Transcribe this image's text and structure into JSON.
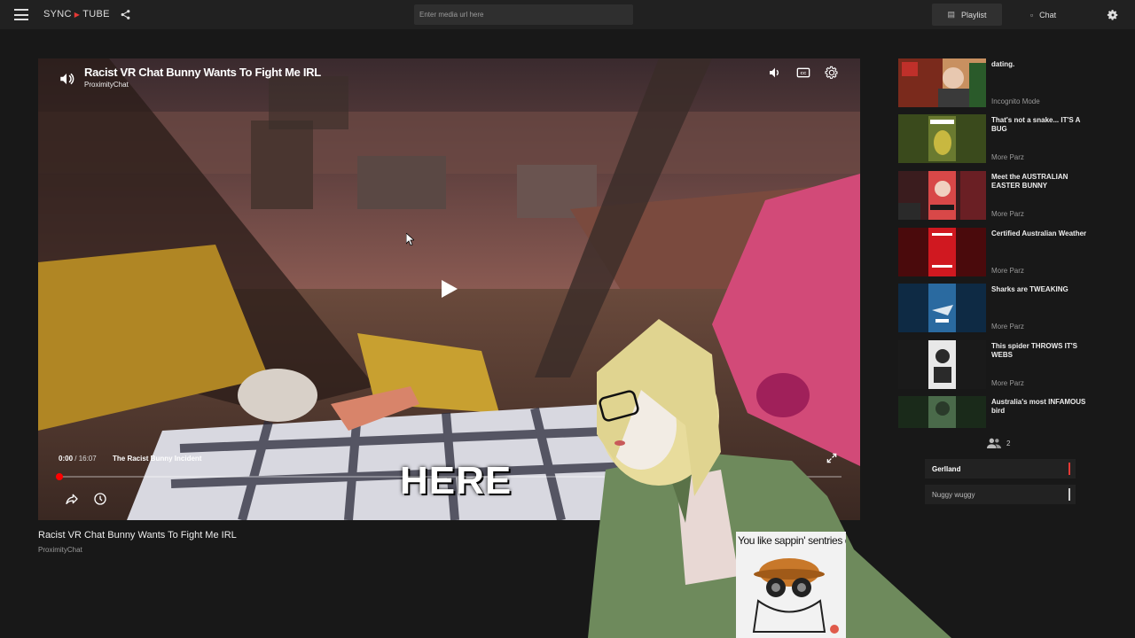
{
  "app": {
    "brand_left": "SYNC",
    "brand_right": "TUBE"
  },
  "header": {
    "url_placeholder": "Enter media url here",
    "tabs": [
      {
        "label": "Playlist",
        "icon": "playlist-icon",
        "active": true
      },
      {
        "label": "Chat",
        "icon": "chat-icon",
        "active": false
      }
    ]
  },
  "player": {
    "title": "Racist VR Chat Bunny Wants To Fight Me IRL",
    "channel": "ProximityChat",
    "current_time": "0:00",
    "separator": " / ",
    "duration": "16:07",
    "chapter": "The Racist Bunny Incident",
    "progress_fraction": 0.0,
    "caption_overlay": "HERE"
  },
  "video_info": {
    "title": "Racist VR Chat Bunny Wants To Fight Me IRL",
    "channel": "ProximityChat"
  },
  "playlist": [
    {
      "title": "dating.",
      "author": "Incognito Mode",
      "thumb_color": "#7a2a1c"
    },
    {
      "title": "That's not a snake... IT'S A BUG",
      "author": "More Parz",
      "thumb_color": "#4a5a24"
    },
    {
      "title": "Meet the AUSTRALIAN EASTER BUNNY",
      "author": "More Parz",
      "thumb_color": "#6a1f24"
    },
    {
      "title": "Certified Australian Weather",
      "author": "More Parz",
      "thumb_color": "#8a0e12"
    },
    {
      "title": "Sharks are TWEAKING",
      "author": "More Parz",
      "thumb_color": "#1d3e5a"
    },
    {
      "title": "This spider THROWS IT'S WEBS",
      "author": "More Parz",
      "thumb_color": "#2a2a2a"
    },
    {
      "title": "Australia's most INFAMOUS bird",
      "author": "",
      "thumb_color": "#2f4a2c"
    }
  ],
  "users": {
    "count": "2",
    "list": [
      {
        "name": "Gerlland",
        "bar_color": "#e53935",
        "bold": true
      },
      {
        "name": "Nuggy wuggy",
        "bar_color": "#cccccc",
        "bold": false
      }
    ]
  },
  "overlay": {
    "meme_text": "You like sappin' sentries don't you"
  }
}
